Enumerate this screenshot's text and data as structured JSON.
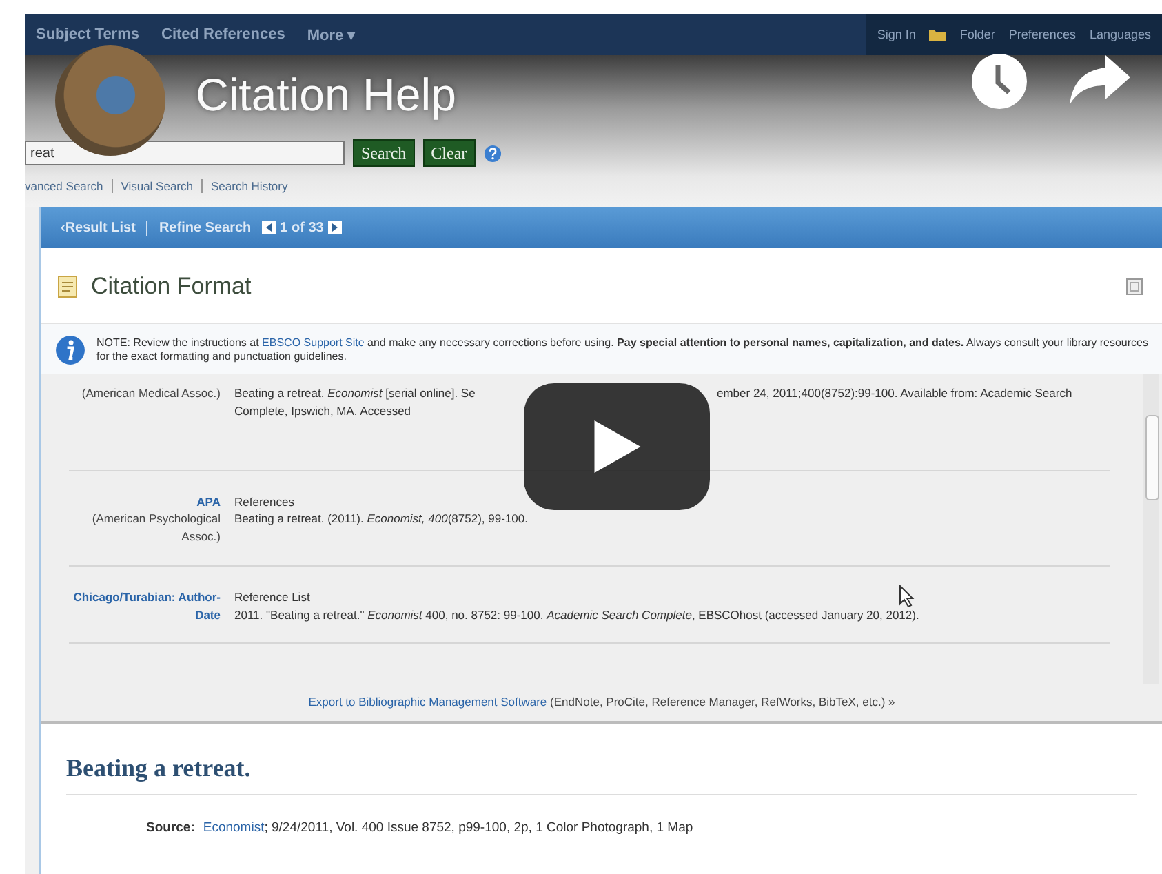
{
  "video": {
    "title": "Citation Help"
  },
  "nav": {
    "left": [
      "Subject Terms",
      "Cited References",
      "More ▾"
    ],
    "right": [
      "Sign In",
      "Folder",
      "Preferences",
      "Languages"
    ]
  },
  "search": {
    "value": "reat",
    "buttons": [
      "Search",
      "Clear"
    ],
    "links": [
      "vanced Search",
      "Visual Search",
      "Search History"
    ]
  },
  "result_bar": {
    "back": "‹Result List",
    "refine": "Refine Search",
    "position": "1 of 33"
  },
  "panel": {
    "title": "Citation Format",
    "note": {
      "before": "NOTE: Review the instructions at ",
      "link": "EBSCO Support Site",
      "after": " and make any necessary corrections before using. **Pay special attention to personal names, capitalization, and dates.** Always consult your library resources for the exact formatting and punctuation guidelines."
    },
    "citations": [
      {
        "kind": "covered",
        "style_note": "(American Medical Assoc.)",
        "lines": [
          [
            "Beating a retreat. *Economist* [serial online]. Se",
            "ember 24, 2011;400(8752):99-100. Available from: Academic Search"
          ],
          [
            "Complete, Ipswich, MA. Accessed"
          ]
        ]
      },
      {
        "kind": "full",
        "style": "APA",
        "style_note": "(American Psychological Assoc.)",
        "heading": "References",
        "text": "Beating a retreat. (2011). *Economist, 400*(8752), 99-100."
      },
      {
        "kind": "full",
        "style": "Chicago/Turabian: Author-Date",
        "heading": "Reference List",
        "text": "2011. \"Beating a retreat.\" *Economist* 400, no. 8752: 99-100. *Academic Search Complete*, EBSCOhost (accessed January 20, 2012)."
      }
    ],
    "export": {
      "link": "Export to Bibliographic Management Software",
      "rest": " (EndNote, ProCite, Reference Manager, RefWorks, BibTeX, etc.) »"
    }
  },
  "record": {
    "title": "Beating a retreat.",
    "source_label": "Source:",
    "source_link": "Economist",
    "source_rest": "; 9/24/2011, Vol. 400 Issue 8752, p99-100, 2p, 1 Color Photograph, 1 Map"
  }
}
